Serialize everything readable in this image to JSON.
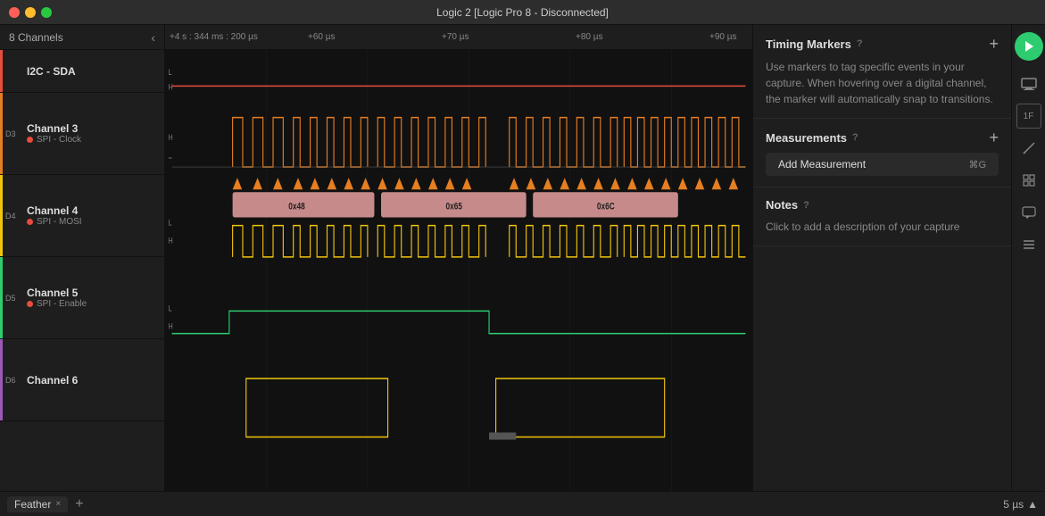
{
  "titlebar": {
    "title": "Logic 2 [Logic Pro 8 - Disconnected]"
  },
  "sidebar": {
    "header_title": "8 Channels",
    "channels": [
      {
        "id": "",
        "name": "I2C - SDA",
        "color": "#e74c3c",
        "protocol": "",
        "height_class": "channel-item-i2c"
      },
      {
        "id": "D3",
        "name": "Channel 3",
        "color": "#e67e22",
        "protocol": "SPI - Clock",
        "protocol_color": "#e74c3c",
        "height_class": "channel-item-ch3"
      },
      {
        "id": "D4",
        "name": "Channel 4",
        "color": "#f1c40f",
        "protocol": "SPI - MOSI",
        "protocol_color": "#e74c3c",
        "height_class": "channel-item-ch4"
      },
      {
        "id": "D5",
        "name": "Channel 5",
        "color": "#2ecc71",
        "protocol": "SPI - Enable",
        "protocol_color": "#e74c3c",
        "height_class": "channel-item-ch5"
      },
      {
        "id": "D6",
        "name": "Channel 6",
        "color": "#9b59b6",
        "protocol": "",
        "height_class": "channel-item-ch6"
      }
    ]
  },
  "time_ruler": {
    "time_offset": "+4 s : 344 ms : 200 µs",
    "marks": [
      "+60 µs",
      "+70 µs",
      "+80 µs",
      "+90 µs"
    ]
  },
  "right_panel": {
    "timing_markers": {
      "title": "Timing Markers",
      "description": "Use markers to tag specific events in your capture. When hovering over a digital channel, the marker will automatically snap to transitions."
    },
    "measurements": {
      "title": "Measurements",
      "button_label": "Add Measurement",
      "shortcut": "⌘G"
    },
    "notes": {
      "title": "Notes",
      "placeholder": "Click to add a description of your capture"
    }
  },
  "bottombar": {
    "tab_label": "Feather",
    "sample_rate": "5 µs"
  },
  "icons": {
    "collapse": "‹",
    "add": "+",
    "help": "?",
    "play": "▶",
    "chevron_up": "▲",
    "close_tab": "×"
  }
}
